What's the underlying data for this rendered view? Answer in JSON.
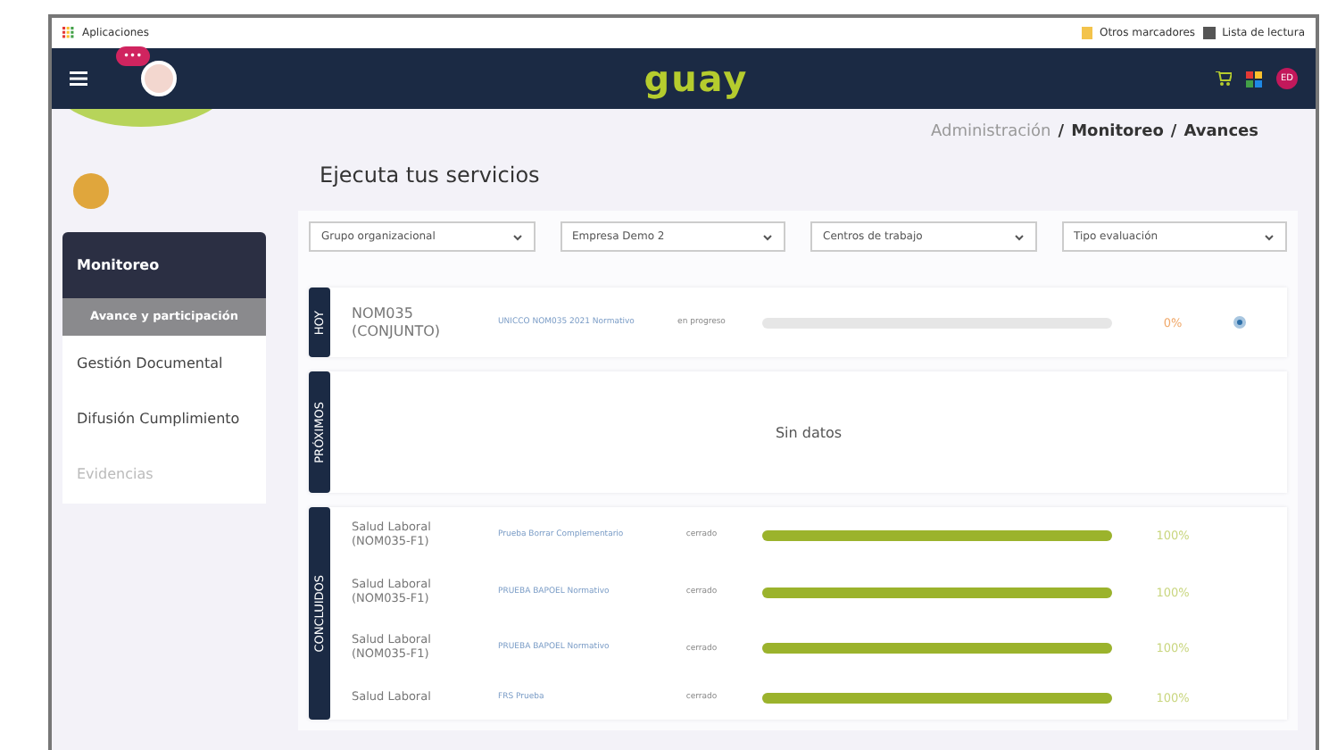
{
  "bookmarks_bar": {
    "apps": "Aplicaciones",
    "other": "Otros marcadores",
    "reading": "Lista de lectura"
  },
  "navbar": {
    "logo": "guay",
    "chat_badge": "•••",
    "user_initials": "ED"
  },
  "breadcrumb_separator": "/",
  "breadcrumb": [
    {
      "label": "Administración",
      "current": false
    },
    {
      "label": "Monitoreo",
      "current": true
    },
    {
      "label": "Avances",
      "current": true
    }
  ],
  "page_title": "Ejecuta tus servicios",
  "sidebar": {
    "section": "Monitoreo",
    "items": [
      {
        "label": "Avance y participación",
        "selected": true,
        "disabled": false
      },
      {
        "label": "Gestión Documental",
        "selected": false,
        "disabled": false
      },
      {
        "label": "Difusión Cumplimiento",
        "selected": false,
        "disabled": false
      },
      {
        "label": "Evidencias",
        "selected": false,
        "disabled": true
      }
    ]
  },
  "filters": [
    {
      "value": "Grupo organizacional"
    },
    {
      "value": "Empresa Demo 2"
    },
    {
      "value": "Centros de trabajo"
    },
    {
      "value": "Tipo evaluación"
    }
  ],
  "sections": [
    {
      "label": "HOY",
      "rows": [
        {
          "name": "NOM035 (CONJUNTO)",
          "survey": "UNICCO NOM035 2021 Normativo",
          "status": "en progreso",
          "level": 0,
          "percent": "0%",
          "kind": "current"
        }
      ]
    },
    {
      "label": "PRÓXIMOS",
      "empty_text": "Sin datos"
    },
    {
      "label": "CONCLUIDOS",
      "rows": [
        {
          "name": "Salud Laboral (NOM035-F1)",
          "survey": "Prueba Borrar Complementario",
          "status": "cerrado",
          "level": 1,
          "percent": "100%",
          "kind": "done"
        },
        {
          "name": "Salud Laboral (NOM035-F1)",
          "survey": "PRUEBA BAPOEL Normativo",
          "status": "cerrado",
          "level": 1,
          "percent": "100%",
          "kind": "done"
        },
        {
          "name": "Salud Laboral (NOM035-F1)",
          "survey": "PRUEBA BAPOEL Normativo",
          "status": "cerrado",
          "level": 1,
          "percent": "100%",
          "kind": "done"
        },
        {
          "name": "Salud Laboral",
          "survey": "FRS Prueba",
          "status": "cerrado",
          "level": 1,
          "percent": "100%",
          "kind": "done"
        }
      ]
    }
  ]
}
